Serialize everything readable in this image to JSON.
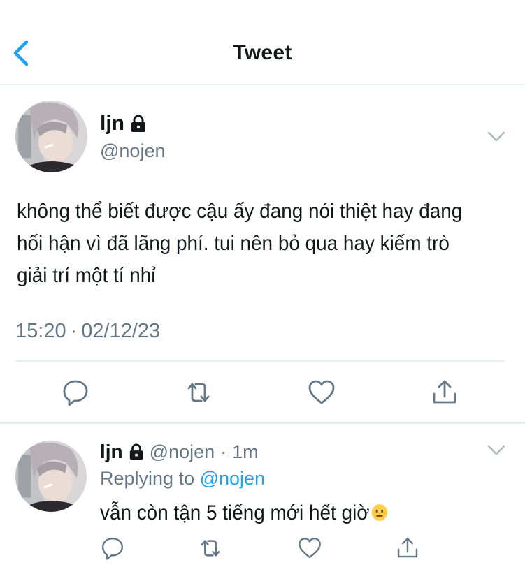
{
  "header": {
    "title": "Tweet",
    "back_icon": "chevron-left-icon",
    "accent_color": "#1da1f2"
  },
  "main_tweet": {
    "display_name": "ljn",
    "protected_icon": "lock-icon",
    "handle": "@nojen",
    "text": "không thể biết được cậu ấy đang nói thiệt hay đang hối hận vì đã lãng phí. tui nên bỏ qua hay kiếm trò giải trí một tí nhỉ",
    "time": "15:20",
    "separator": "·",
    "date": "02/12/23",
    "actions": [
      "reply-icon",
      "retweet-icon",
      "like-icon",
      "share-icon"
    ]
  },
  "reply_tweet": {
    "display_name": "ljn",
    "protected_icon": "lock-icon",
    "handle": "@nojen",
    "separator": "·",
    "age": "1m",
    "replying_prefix": "Replying to",
    "replying_to": "@nojen",
    "text": "vẫn còn tận 5 tiếng mới hết giờ",
    "emoji": "neutral-face-emoji",
    "actions": [
      "reply-icon",
      "retweet-icon",
      "like-icon",
      "share-icon"
    ]
  },
  "colors": {
    "text_primary": "#14171a",
    "text_secondary": "#657786",
    "divider": "#e6ecf0",
    "link": "#1da1f2"
  }
}
